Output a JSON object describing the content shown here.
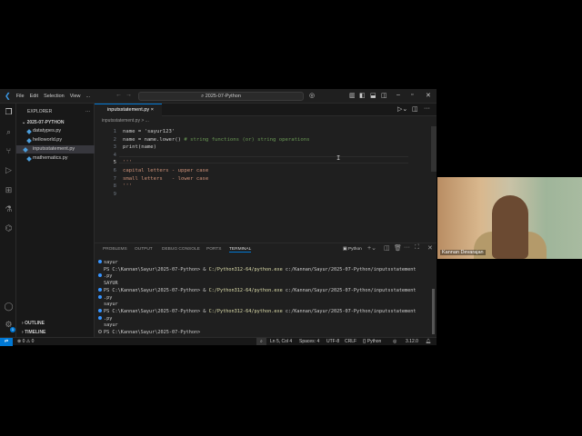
{
  "menu": [
    "File",
    "Edit",
    "Selection",
    "View",
    "..."
  ],
  "command_center": "⌕ 2025-07-Python",
  "explorer": {
    "title": "EXPLORER",
    "folder": "2025-07-PYTHON",
    "files": [
      "datatypes.py",
      "helloworld.py",
      "inputsstatement.py",
      "mathematics.py"
    ],
    "outline": "OUTLINE",
    "timeline": "TIMELINE"
  },
  "tab": {
    "label": "inputsstatement.py",
    "close": "×"
  },
  "breadcrumb": "inputsstatement.py > ...",
  "code": [
    {
      "n": "1",
      "t": "name = 'sayur123'"
    },
    {
      "n": "2",
      "t": "name = name.lower() # string functions (or) string operations"
    },
    {
      "n": "3",
      "t": "print(name)"
    },
    {
      "n": "4",
      "t": ""
    },
    {
      "n": "5",
      "t": "'''"
    },
    {
      "n": "6",
      "t": "capital letters - upper case"
    },
    {
      "n": "7",
      "t": "small letters   - lower case"
    },
    {
      "n": "8",
      "t": "'''"
    },
    {
      "n": "9",
      "t": ""
    }
  ],
  "panel_tabs": [
    "PROBLEMS",
    "OUTPUT",
    "DEBUG CONSOLE",
    "PORTS",
    "TERMINAL"
  ],
  "terminal_profile": "Python",
  "terminal": [
    "sayur",
    "PS C:\\Kannan\\Sayur\\2025-07-Python> & C:/Python312-64/python.exe c:/Kannan/Sayur/2025-07-Python/inputsstatement",
    ".py",
    "SAYUR",
    "PS C:\\Kannan\\Sayur\\2025-07-Python> & C:/Python312-64/python.exe c:/Kannan/Sayur/2025-07-Python/inputsstatement",
    ".py",
    "sayur",
    "PS C:\\Kannan\\Sayur\\2025-07-Python> & C:/Python312-64/python.exe c:/Kannan/Sayur/2025-07-Python/inputsstatement",
    ".py",
    "sayur",
    "PS C:\\Kannan\\Sayur\\2025-07-Python>"
  ],
  "status": {
    "problems": "⊗ 0 ⚠ 0",
    "position": "Ln 5, Col 4",
    "spaces": "Spaces: 4",
    "encoding": "UTF-8",
    "eol": "CRLF",
    "language": "{} Python",
    "version": "3.12.0",
    "badge": "1"
  },
  "webcam": {
    "name": "Kannan Devarajan"
  }
}
